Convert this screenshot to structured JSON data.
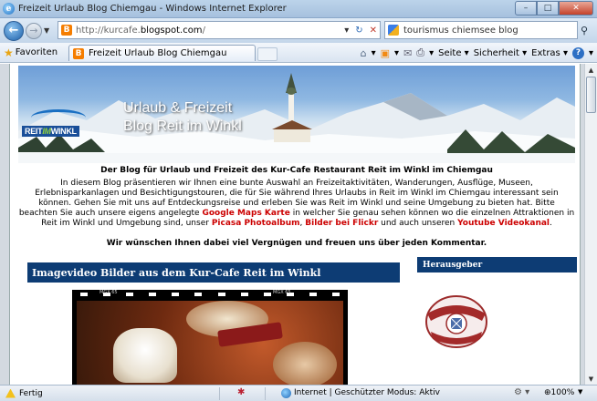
{
  "window": {
    "title": "Freizeit Urlaub Blog Chiemgau - Windows Internet Explorer",
    "buttons": {
      "minimize": "–",
      "maximize": "□",
      "close": "✕"
    }
  },
  "nav": {
    "url_prefix": "http://kurcafe.",
    "url_domain": "blogspot.com",
    "url_suffix": "/",
    "search_value": "tourismus chiemsee blog"
  },
  "favorites": {
    "label": "Favoriten",
    "tab_title": "Freizeit Urlaub Blog Chiemgau"
  },
  "commandbar": {
    "page": "Seite",
    "safety": "Sicherheit",
    "extras": "Extras"
  },
  "banner": {
    "title_line1": "Urlaub & Freizeit",
    "title_line2": "Blog Reit im Winkl",
    "logo_part1": "REIT",
    "logo_part2": "IM",
    "logo_part3": "WINKL"
  },
  "content": {
    "tagline": "Der Blog für Urlaub und Freizeit des Kur-Cafe Restaurant Reit im Winkl im Chiemgau",
    "intro_1": "In diesem Blog präsentieren wir Ihnen eine bunte Auswahl an Freizeitaktivitäten, Wanderungen, Ausflüge, Museen, Erlebnisparkanlagen und Besichtigungstouren, die für Sie während Ihres Urlaubs in Reit im Winkl im Chiemgau interessant sein können. Gehen Sie mit uns auf Entdeckungsreise und erleben Sie was Reit im Winkl und seine Umgebung zu bieten hat. Bitte beachten Sie auch unsere eigens angelegte ",
    "link_maps": "Google Maps Karte",
    "intro_2": " in welcher Sie genau sehen können wo die einzelnen Attraktionen in Reit im Winkl und Umgebung sind, unser ",
    "link_picasa": "Picasa Photoalbum",
    "intro_3": ", ",
    "link_flickr": "Bilder bei Flickr",
    "intro_4": " und auch unseren ",
    "link_youtube": "Youtube Videokanal",
    "intro_5": ".",
    "wish": "Wir wünschen Ihnen dabei viel Vergnügen und freuen uns über jeden Kommentar.",
    "post_title": "Imagevideo Bilder aus dem Kur-Cafe Reit im Winkl",
    "film_label": "MGX 65",
    "sidebar_title": "Herausgeber"
  },
  "status": {
    "text": "Fertig",
    "zone": "Internet | Geschützter Modus: Aktiv",
    "zoom": "100%"
  }
}
